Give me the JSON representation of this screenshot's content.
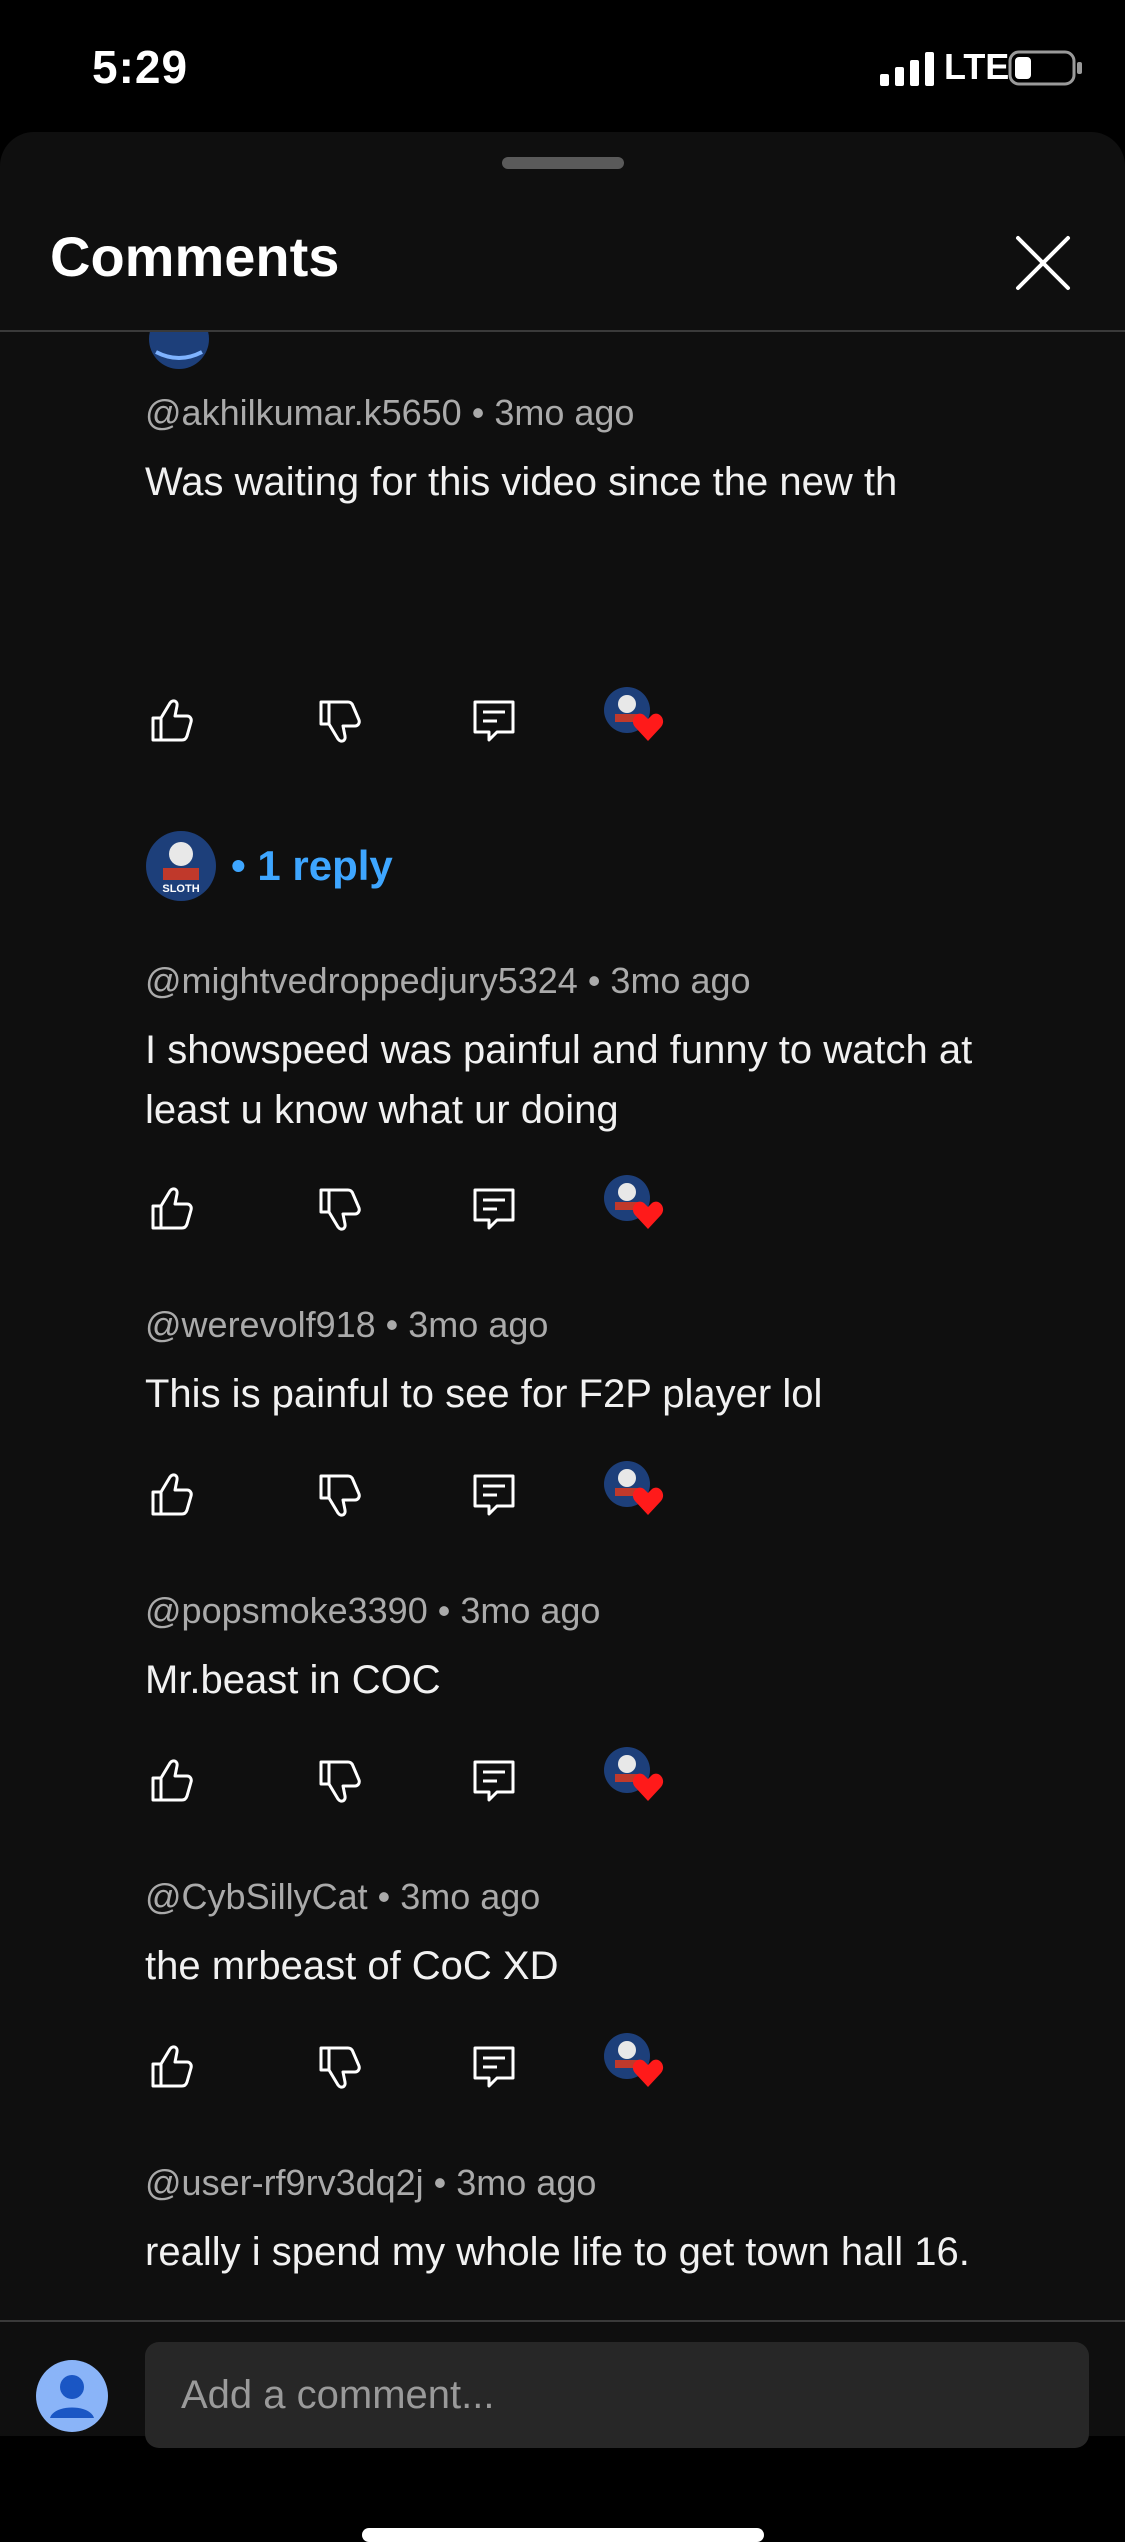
{
  "status_bar": {
    "time": "5:29",
    "network": "LTE"
  },
  "panel": {
    "title": "Comments"
  },
  "comments": [
    {
      "author": "@akhilkumar.k5650",
      "age": "3mo ago",
      "text": "Was waiting for this video since the new th"
    },
    {
      "author": "@mightvedroppedjury5324",
      "age": "3mo ago",
      "text": "I showspeed was painful and funny to watch at least u know what ur doing"
    },
    {
      "author": "@werevolf918",
      "age": "3mo ago",
      "text": "This is painful to see for F2P player lol"
    },
    {
      "author": "@popsmoke3390",
      "age": "3mo ago",
      "text": "Mr.beast in COC"
    },
    {
      "author": "@CybSillyCat",
      "age": "3mo ago",
      "text": "the mrbeast of CoC XD"
    },
    {
      "author": "@user-rf9rv3dq2j",
      "age": "3mo ago",
      "text": "really i spend my whole life to get town hall 16."
    }
  ],
  "reply_summary": {
    "label": "1 reply",
    "avatar_text": "SLOTH"
  },
  "composer": {
    "placeholder": "Add a comment..."
  },
  "separator": "•",
  "colors": {
    "background": "#0f0f0f",
    "accent": "#3ea6ff",
    "heart": "#ff1a1a",
    "meta": "#aaaaaa"
  },
  "icons": [
    "like-icon",
    "dislike-icon",
    "reply-icon",
    "creator-heart-icon",
    "close-icon"
  ]
}
